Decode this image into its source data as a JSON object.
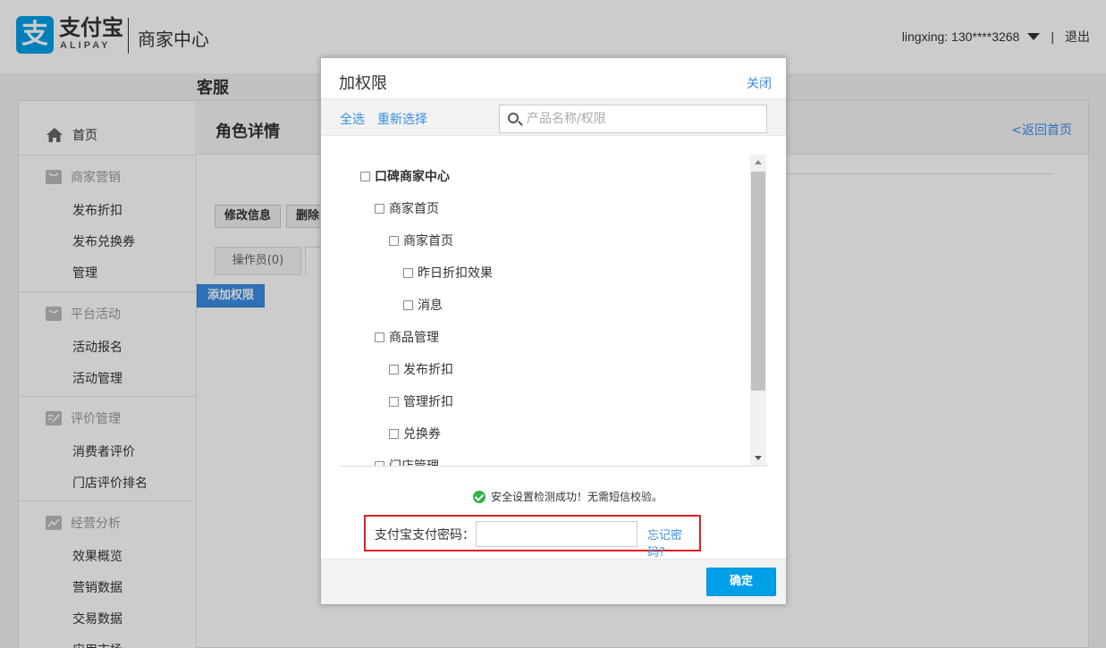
{
  "header": {
    "logo_glyph": "支",
    "logo_name": "支付宝",
    "logo_sub": "ALIPAY",
    "logo_center": "商家中心",
    "user": "lingxing: 130****3268",
    "separator": "|",
    "logout": "退出"
  },
  "sidebar": {
    "home": "首页",
    "groups": [
      {
        "title": "商家营销",
        "icon": "bag-icon",
        "items": [
          "发布折扣",
          "发布兑换券",
          "管理"
        ]
      },
      {
        "title": "平台活动",
        "icon": "bag-icon",
        "items": [
          "活动报名",
          "活动管理"
        ]
      },
      {
        "title": "评价管理",
        "icon": "edit-icon",
        "items": [
          "消费者评价",
          "门店评价排名"
        ]
      },
      {
        "title": "经营分析",
        "icon": "chart-icon",
        "items": [
          "效果概览",
          "营销数据",
          "交易数据",
          "应用市场"
        ]
      }
    ]
  },
  "main": {
    "title": "角色详情",
    "back": "<返回首页",
    "role_name": "客服",
    "edit_button": "修改信息",
    "delete_button": "删除",
    "tab_operators": "操作员(0)",
    "add_permission": "添加权限"
  },
  "modal": {
    "title": "加权限",
    "close": "关闭",
    "select_all": "全选",
    "reselect": "重新选择",
    "search_placeholder": "产品名称/权限",
    "tree": [
      {
        "label": "口碑商家中心",
        "level": 0,
        "bold": true
      },
      {
        "label": "商家首页",
        "level": 1
      },
      {
        "label": "商家首页",
        "level": 2
      },
      {
        "label": "昨日折扣效果",
        "level": 3
      },
      {
        "label": "消息",
        "level": 3
      },
      {
        "label": "商品管理",
        "level": 1
      },
      {
        "label": "发布折扣",
        "level": 2
      },
      {
        "label": "管理折扣",
        "level": 2
      },
      {
        "label": "兑换券",
        "level": 2
      },
      {
        "label": "门店管理",
        "level": 1
      }
    ],
    "security_msg": "安全设置检测成功！无需短信校验。",
    "password_label": "支付宝支付密码：",
    "forgot_password": "忘记密码?",
    "confirm": "确定"
  },
  "colors": {
    "accent": "#00a0e9",
    "link": "#3a8ee6",
    "highlight_border": "#e02020",
    "success": "#2eb34a"
  }
}
